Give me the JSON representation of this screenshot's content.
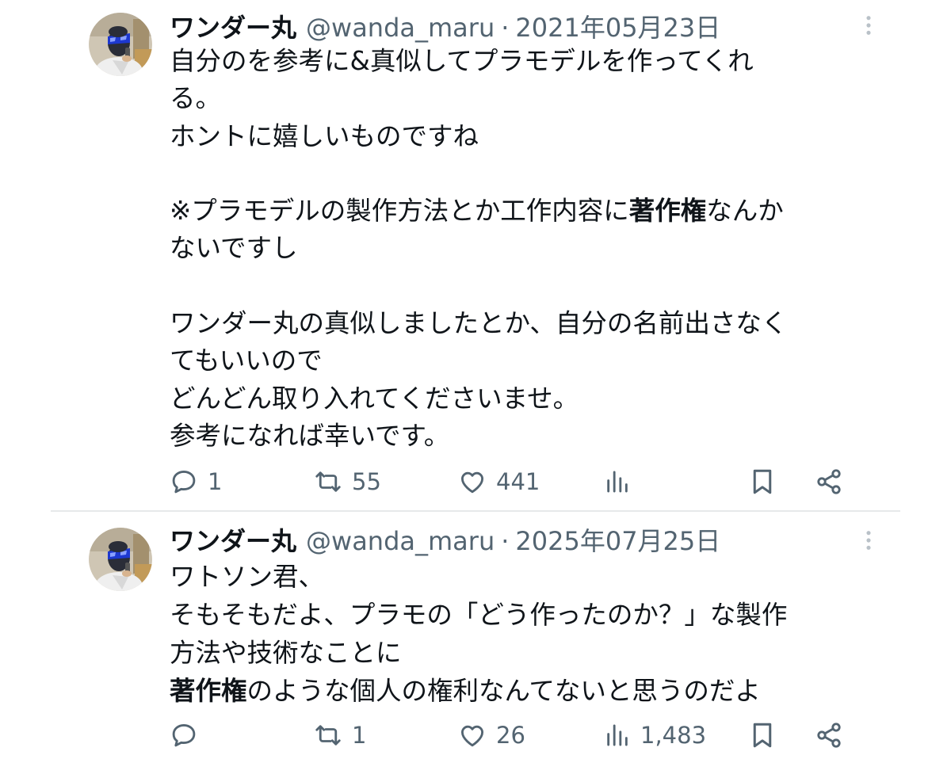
{
  "tweets": [
    {
      "name": "ワンダー丸",
      "handle": "@wanda_maru",
      "separator": "·",
      "date": "2021年05月23日",
      "body": {
        "l1": "自分のを参考に&真似してプラモデルを作ってくれ",
        "l2": "る。",
        "l3": "ホントに嬉しいものですね",
        "l4a": "※プラモデルの製作方法とか工作内容に",
        "l4b": "著作権",
        "l4c": "なんか",
        "l5": "ないですし",
        "l6": "ワンダー丸の真似しましたとか、自分の名前出さなく",
        "l7": "てもいいので",
        "l8": "どんどん取り入れてくださいませ。",
        "l9": "参考になれば幸いです。"
      },
      "counts": {
        "reply": "1",
        "retweet": "55",
        "like": "441",
        "views": ""
      }
    },
    {
      "name": "ワンダー丸",
      "handle": "@wanda_maru",
      "separator": "·",
      "date": "2025年07月25日",
      "body": {
        "l1": "ワトソン君、",
        "l2": "そもそもだよ、プラモの「どう作ったのか？」な製作",
        "l3": "方法や技術なことに",
        "l4a": "著作権",
        "l4b": "のような個人の権利なんてないと思うのだよ"
      },
      "counts": {
        "reply": "",
        "retweet": "1",
        "like": "26",
        "views": "1,483"
      }
    }
  ],
  "icons": {
    "more": "more-vertical-icon",
    "reply": "reply-icon",
    "retweet": "retweet-icon",
    "like": "heart-icon",
    "views": "views-icon",
    "bookmark": "bookmark-icon",
    "share": "share-icon"
  },
  "colors": {
    "text": "#0f1419",
    "secondary": "#536471",
    "divider": "#e7e9ea",
    "more_dots": "#b9c1c8"
  }
}
